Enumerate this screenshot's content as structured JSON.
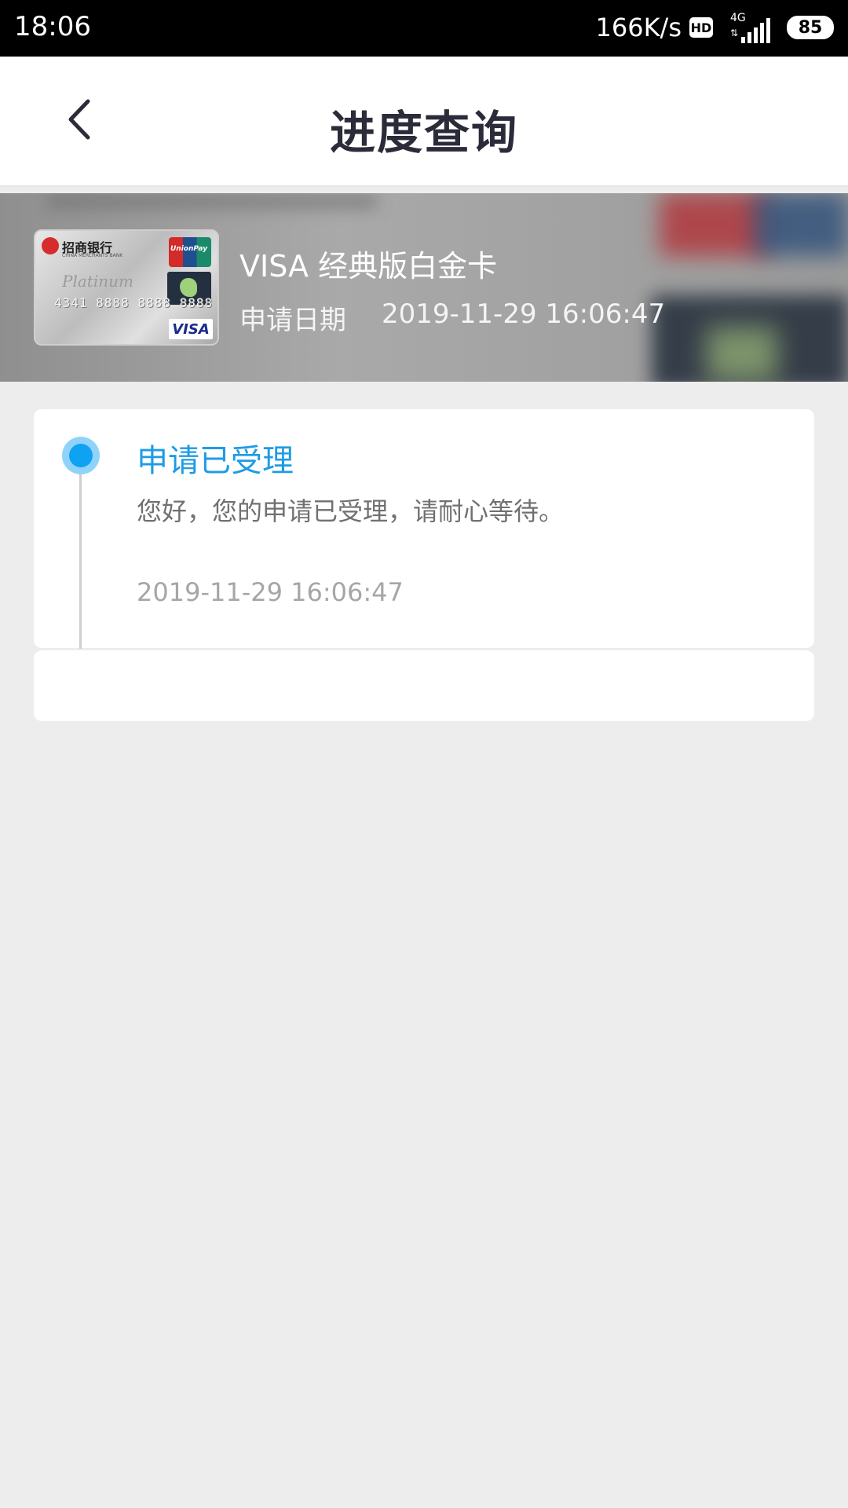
{
  "status_bar": {
    "time": "18:06",
    "net_speed": "166K/s",
    "hd": "HD",
    "network": "4G",
    "battery": "85"
  },
  "header": {
    "title": "进度查询",
    "back_icon": "chevron-left-icon"
  },
  "card": {
    "image_bank_name": "招商银行",
    "image_card_number": "4341 8888 8888 8888",
    "image_brand": "VISA",
    "image_network": "UnionPay",
    "name": "VISA 经典版白金卡",
    "date_label": "申请日期",
    "date_value": "2019-11-29 16:06:47"
  },
  "progress": {
    "steps": [
      {
        "title": "申请已受理",
        "description": "您好，您的申请已受理，请耐心等待。",
        "time": "2019-11-29 16:06:47",
        "active_color": "#1e9be6"
      }
    ]
  },
  "colors": {
    "background": "#ededed",
    "accent": "#1e9be6",
    "title_text": "#2b2b3a"
  }
}
